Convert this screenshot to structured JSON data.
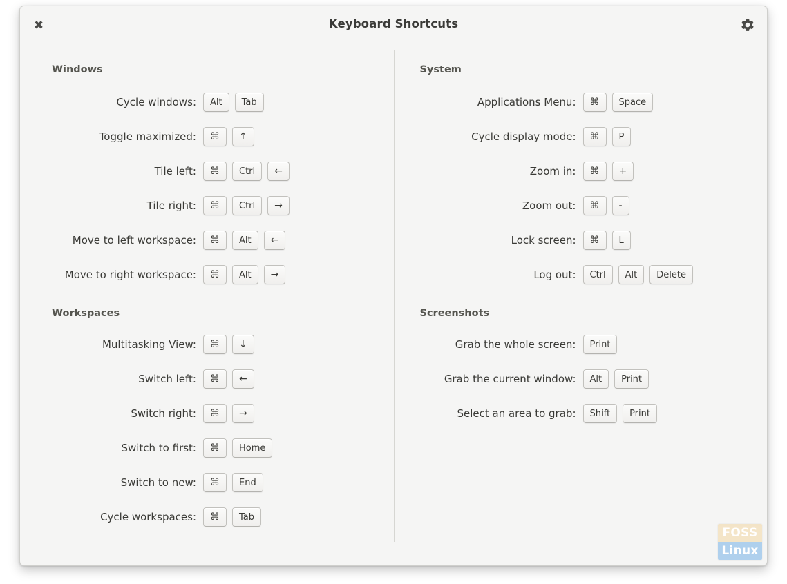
{
  "window": {
    "title": "Keyboard Shortcuts",
    "close_icon": "close-icon",
    "close_glyph": "✖",
    "settings_icon": "gear-icon"
  },
  "colors": {
    "window_bg": "#f5f5f4",
    "text": "#3a3a36",
    "section_title": "#55554f",
    "key_border": "#c2c1bd",
    "divider": "#d6d6d2",
    "watermark_top_bg": "#f3e3c4",
    "watermark_bottom_bg": "#a9cdec"
  },
  "left_column": {
    "sections": [
      {
        "title": "Windows",
        "rows": [
          {
            "label": "Cycle windows:",
            "keys": [
              "Alt",
              "Tab"
            ]
          },
          {
            "label": "Toggle maximized:",
            "keys": [
              "⌘",
              "↑"
            ]
          },
          {
            "label": "Tile left:",
            "keys": [
              "⌘",
              "Ctrl",
              "←"
            ]
          },
          {
            "label": "Tile right:",
            "keys": [
              "⌘",
              "Ctrl",
              "→"
            ]
          },
          {
            "label": "Move to left workspace:",
            "keys": [
              "⌘",
              "Alt",
              "←"
            ]
          },
          {
            "label": "Move to right workspace:",
            "keys": [
              "⌘",
              "Alt",
              "→"
            ]
          }
        ]
      },
      {
        "title": "Workspaces",
        "rows": [
          {
            "label": "Multitasking View:",
            "keys": [
              "⌘",
              "↓"
            ]
          },
          {
            "label": "Switch left:",
            "keys": [
              "⌘",
              "←"
            ]
          },
          {
            "label": "Switch right:",
            "keys": [
              "⌘",
              "→"
            ]
          },
          {
            "label": "Switch to first:",
            "keys": [
              "⌘",
              "Home"
            ]
          },
          {
            "label": "Switch to new:",
            "keys": [
              "⌘",
              "End"
            ]
          },
          {
            "label": "Cycle workspaces:",
            "keys": [
              "⌘",
              "Tab"
            ]
          }
        ]
      }
    ]
  },
  "right_column": {
    "sections": [
      {
        "title": "System",
        "rows": [
          {
            "label": "Applications Menu:",
            "keys": [
              "⌘",
              "Space"
            ]
          },
          {
            "label": "Cycle display mode:",
            "keys": [
              "⌘",
              "P"
            ]
          },
          {
            "label": "Zoom in:",
            "keys": [
              "⌘",
              "+"
            ]
          },
          {
            "label": "Zoom out:",
            "keys": [
              "⌘",
              "-"
            ]
          },
          {
            "label": "Lock screen:",
            "keys": [
              "⌘",
              "L"
            ]
          },
          {
            "label": "Log out:",
            "keys": [
              "Ctrl",
              "Alt",
              "Delete"
            ]
          }
        ]
      },
      {
        "title": "Screenshots",
        "rows": [
          {
            "label": "Grab the whole screen:",
            "keys": [
              "Print"
            ]
          },
          {
            "label": "Grab the current window:",
            "keys": [
              "Alt",
              "Print"
            ]
          },
          {
            "label": "Select an area to grab:",
            "keys": [
              "Shift",
              "Print"
            ]
          }
        ]
      }
    ]
  },
  "watermark": {
    "line1": "FOSS",
    "line2": "Linux"
  }
}
